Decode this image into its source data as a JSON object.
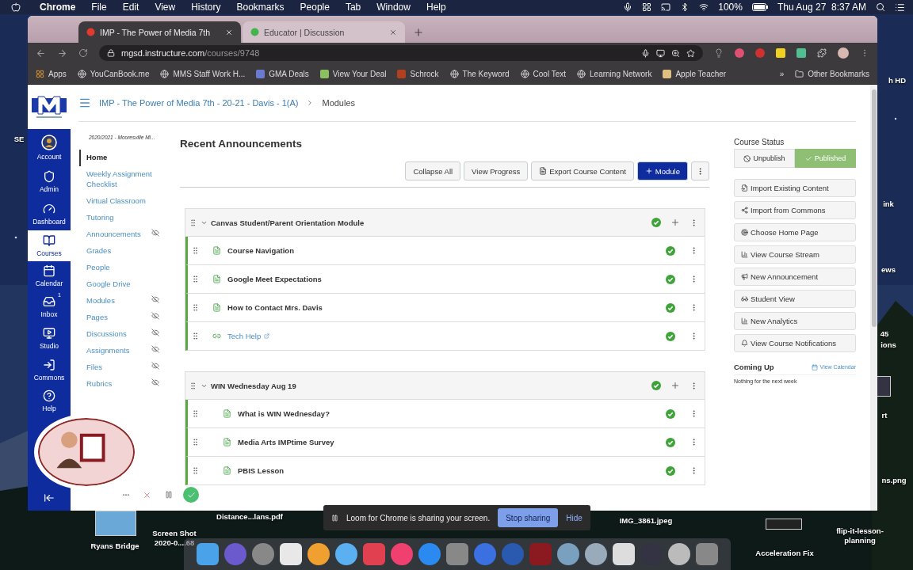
{
  "menubar": {
    "items": [
      "Chrome",
      "File",
      "Edit",
      "View",
      "History",
      "Bookmarks",
      "People",
      "Tab",
      "Window",
      "Help"
    ],
    "battery": "100%",
    "clock": "Thu Aug 27  8:37 AM"
  },
  "browser": {
    "tabs": [
      {
        "title": "IMP - The Power of Media 7th",
        "selected": true
      },
      {
        "title": "Educator | Discussion",
        "selected": false
      }
    ],
    "address": {
      "host": "mgsd.instructure.com",
      "path": "/courses/9748"
    },
    "bookmarks": [
      "Apps",
      "YouCanBook.me",
      "MMS Staff Work H...",
      "GMA Deals",
      "View Your Deal",
      "Schrock",
      "The Keyword",
      "Cool Text",
      "Learning Network",
      "Apple Teacher"
    ],
    "overflow": "»",
    "other_bookmarks": "Other Bookmarks"
  },
  "global_nav": [
    {
      "label": "Account",
      "selected": false
    },
    {
      "label": "Admin",
      "selected": false
    },
    {
      "label": "Dashboard",
      "selected": false
    },
    {
      "label": "Courses",
      "selected": true
    },
    {
      "label": "Calendar",
      "selected": false
    },
    {
      "label": "Inbox",
      "selected": false,
      "badge": "1"
    },
    {
      "label": "Studio",
      "selected": false
    },
    {
      "label": "Commons",
      "selected": false
    },
    {
      "label": "Help",
      "selected": false
    }
  ],
  "breadcrumb": [
    "IMP - The Power of Media 7th - 20-21 - Davis - 1(A)",
    "Modules"
  ],
  "term": "2020/2021 - Mooresville Mi...",
  "course_nav": [
    {
      "label": "Home",
      "selected": true,
      "hidden": false
    },
    {
      "label": "Weekly Assignment Checklist",
      "selected": false,
      "hidden": false
    },
    {
      "label": "Virtual Classroom",
      "selected": false,
      "hidden": false
    },
    {
      "label": "Tutoring",
      "selected": false,
      "hidden": false
    },
    {
      "label": "Announcements",
      "selected": false,
      "hidden": true
    },
    {
      "label": "Grades",
      "selected": false,
      "hidden": false
    },
    {
      "label": "People",
      "selected": false,
      "hidden": false
    },
    {
      "label": "Google Drive",
      "selected": false,
      "hidden": false
    },
    {
      "label": "Modules",
      "selected": false,
      "hidden": true
    },
    {
      "label": "Pages",
      "selected": false,
      "hidden": true
    },
    {
      "label": "Discussions",
      "selected": false,
      "hidden": true
    },
    {
      "label": "Assignments",
      "selected": false,
      "hidden": true
    },
    {
      "label": "Files",
      "selected": false,
      "hidden": true
    },
    {
      "label": "Rubrics",
      "selected": false,
      "hidden": true
    }
  ],
  "heading": "Recent Announcements",
  "toolbar": {
    "collapse": "Collapse All",
    "progress": "View Progress",
    "export": "Export Course Content",
    "add_module": "Module"
  },
  "modules": [
    {
      "title": "Canvas Student/Parent Orientation Module",
      "published": true,
      "items": [
        {
          "title": "Course Navigation",
          "kind": "page",
          "indented": false,
          "published": true
        },
        {
          "title": "Google Meet Expectations",
          "kind": "page",
          "indented": false,
          "published": true
        },
        {
          "title": "How to Contact Mrs. Davis",
          "kind": "page",
          "indented": false,
          "published": true
        },
        {
          "title": "Tech Help",
          "kind": "link",
          "indented": false,
          "published": true
        }
      ]
    },
    {
      "title": "WIN Wednesday Aug 19",
      "published": true,
      "items": [
        {
          "title": "What is WIN Wednesday?",
          "kind": "page",
          "indented": true,
          "published": true
        },
        {
          "title": "Media Arts IMPtime Survey",
          "kind": "page",
          "indented": true,
          "published": true
        },
        {
          "title": "PBIS Lesson",
          "kind": "page",
          "indented": true,
          "published": true
        }
      ]
    }
  ],
  "sidebar": {
    "status_title": "Course Status",
    "unpublish": "Unpublish",
    "published_label": "Published",
    "published": true,
    "actions": [
      "Import Existing Content",
      "Import from Commons",
      "Choose Home Page",
      "View Course Stream",
      "New Announcement",
      "Student View",
      "New Analytics",
      "View Course Notifications"
    ],
    "coming_up": "Coming Up",
    "view_calendar": "View Calendar",
    "empty": "Nothing for the next week"
  },
  "desktop_labels": [
    "SE",
    "h HD",
    "ink",
    "ews",
    "45",
    "ions",
    "rt",
    "ns.png",
    "Ryans Bridge",
    "Screen Shot 2020-0....68",
    "Distance...lans.pdf",
    "IMG_3861.jpeg",
    "Acceleration Fix",
    "flip-it-lesson-planning"
  ],
  "loom": {
    "message": "Loom for Chrome is sharing your screen.",
    "stop": "Stop sharing",
    "hide": "Hide"
  }
}
